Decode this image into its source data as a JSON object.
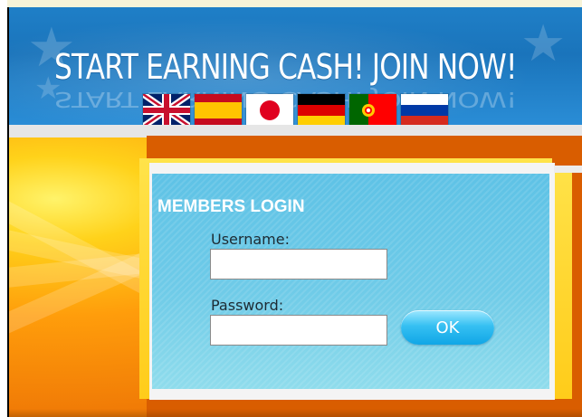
{
  "banner": {
    "headline": "START EARNING CASH! JOIN NOW!",
    "flags": [
      {
        "name": "uk-flag-icon",
        "colors": [
          "#012169",
          "#ffffff",
          "#c8102e"
        ]
      },
      {
        "name": "spain-flag-icon",
        "colors": [
          "#c60b1e",
          "#ffc400"
        ]
      },
      {
        "name": "japan-flag-icon",
        "colors": [
          "#ffffff",
          "#bc002d"
        ]
      },
      {
        "name": "germany-flag-icon",
        "colors": [
          "#000000",
          "#dd0000",
          "#ffce00"
        ]
      },
      {
        "name": "portugal-flag-icon",
        "colors": [
          "#006600",
          "#ff0000",
          "#ffcc00"
        ]
      },
      {
        "name": "russia-flag-icon",
        "colors": [
          "#ffffff",
          "#0039a6",
          "#d52b1e"
        ]
      }
    ]
  },
  "login": {
    "title": "MEMBERS LOGIN",
    "username_label": "Username:",
    "username_value": "",
    "password_label": "Password:",
    "password_value": "",
    "ok_label": "OK"
  },
  "colors": {
    "banner_blue": "#1f7fc7",
    "panel_blue": "#6fcbe8",
    "frame_yellow": "#ffcc1a",
    "orange": "#d95d00"
  }
}
